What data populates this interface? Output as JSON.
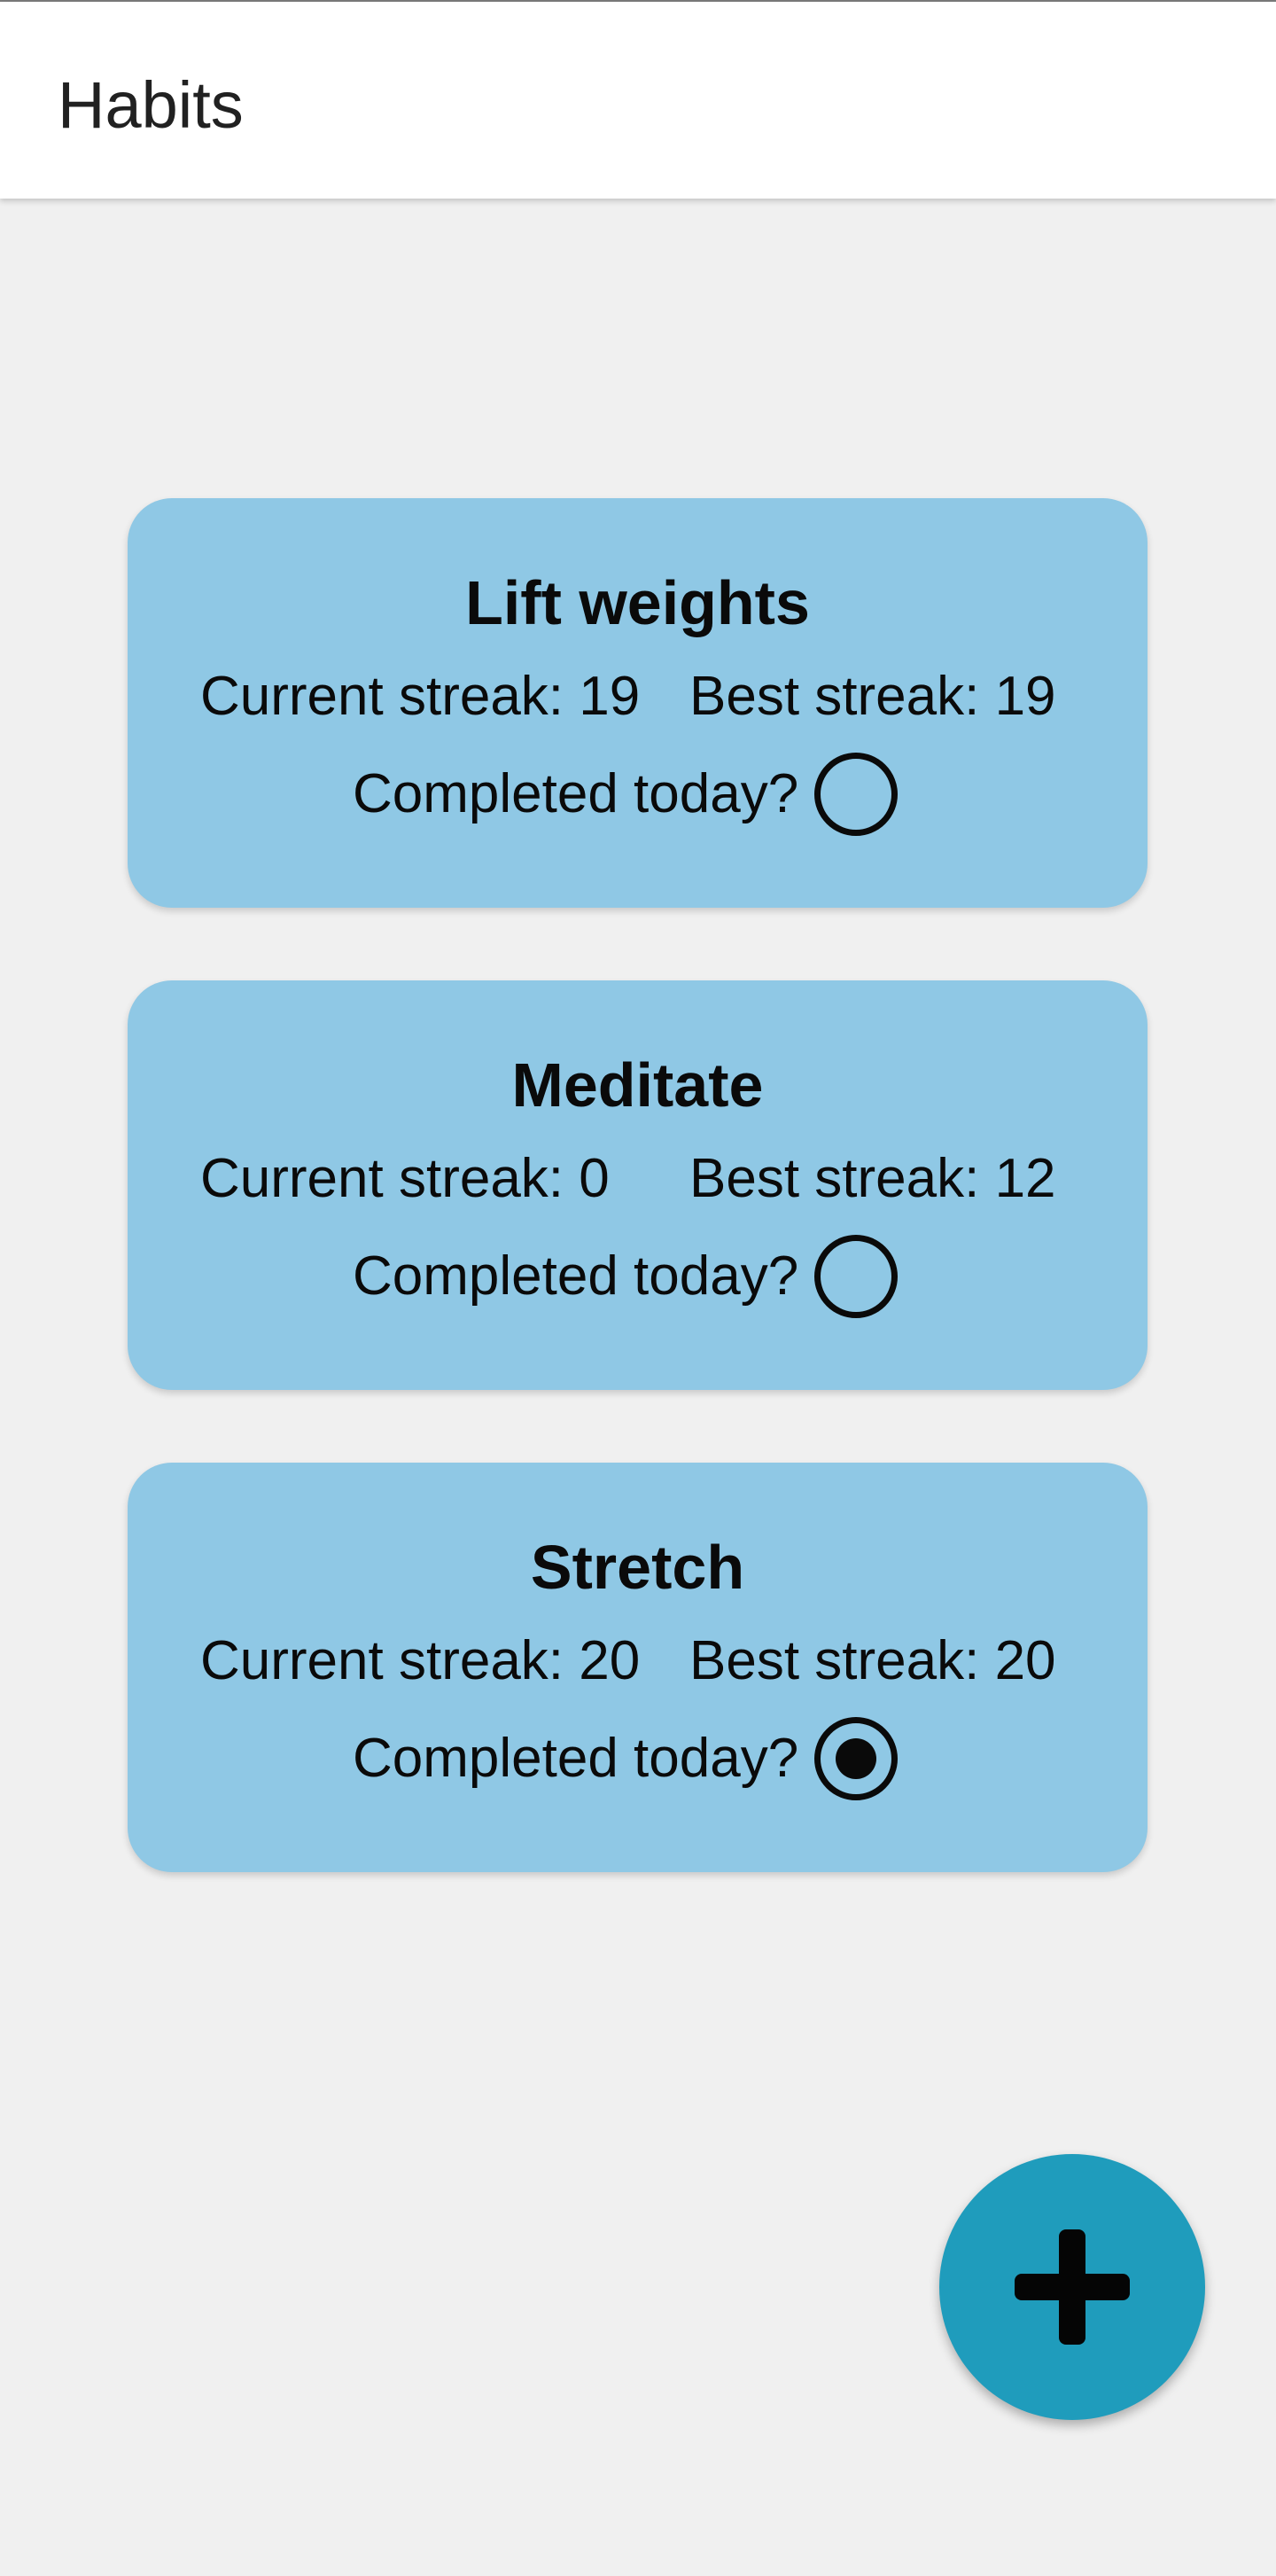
{
  "app_bar": {
    "title": "Habits"
  },
  "habits": [
    {
      "name": "Lift weights",
      "current_streak": "Current streak: 19",
      "best_streak": "Best streak: 19",
      "completed_label": "Completed today?",
      "completed": false
    },
    {
      "name": "Meditate",
      "current_streak": "Current streak: 0",
      "best_streak": "Best streak: 12",
      "completed_label": "Completed today?",
      "completed": false
    },
    {
      "name": "Stretch",
      "current_streak": "Current streak: 20",
      "best_streak": "Best streak: 20",
      "completed_label": "Completed today?",
      "completed": true
    }
  ],
  "fab": {
    "icon": "plus-icon"
  },
  "colors": {
    "card_background": "#8fc8e5",
    "fab_background": "#1f9cbc",
    "page_background": "#f0f0f0",
    "app_bar_background": "#ffffff"
  }
}
